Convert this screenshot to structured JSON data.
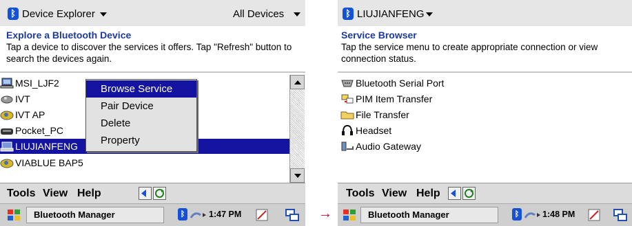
{
  "left": {
    "title": "Device Explorer",
    "filter": "All Devices",
    "header_title": "Explore a Bluetooth Device",
    "header_desc": "Tap a device to discover the services it offers. Tap \"Refresh\" button to search the devices again.",
    "devices": [
      {
        "label": "MSI_LJF2",
        "icon": "computer-icon"
      },
      {
        "label": "IVT",
        "icon": "device-icon"
      },
      {
        "label": "IVT AP",
        "icon": "access-point-icon"
      },
      {
        "label": "Pocket_PC",
        "icon": "pocket-pc-icon"
      },
      {
        "label": "LIUJIANFENG",
        "icon": "laptop-icon",
        "selected": true
      },
      {
        "label": "VIABLUE BAP5",
        "icon": "access-point-icon"
      }
    ],
    "context_menu": [
      "Browse Service",
      "Pair Device",
      "Delete",
      "Property"
    ],
    "menubar": [
      "Tools",
      "View",
      "Help"
    ],
    "taskbar_app": "Bluetooth Manager",
    "clock": "1:47 PM"
  },
  "right": {
    "title": "LIUJIANFENG",
    "header_title": "Service Browser",
    "header_desc": "Tap the service menu to create appropriate connection or view connection status.",
    "services": [
      {
        "label": "Bluetooth Serial Port",
        "icon": "serial-port-icon"
      },
      {
        "label": "PIM Item Transfer",
        "icon": "pim-transfer-icon"
      },
      {
        "label": "File Transfer",
        "icon": "file-transfer-icon"
      },
      {
        "label": "Headset",
        "icon": "headset-icon"
      },
      {
        "label": "Audio Gateway",
        "icon": "audio-gateway-icon"
      }
    ],
    "menubar": [
      "Tools",
      "View",
      "Help"
    ],
    "taskbar_app": "Bluetooth Manager",
    "clock": "1:48 PM"
  },
  "arrow": "→",
  "colors": {
    "accent": "#1414a0",
    "header_title": "#1c3aa0",
    "bluetooth": "#1450d8",
    "arrow": "#d0002a"
  }
}
